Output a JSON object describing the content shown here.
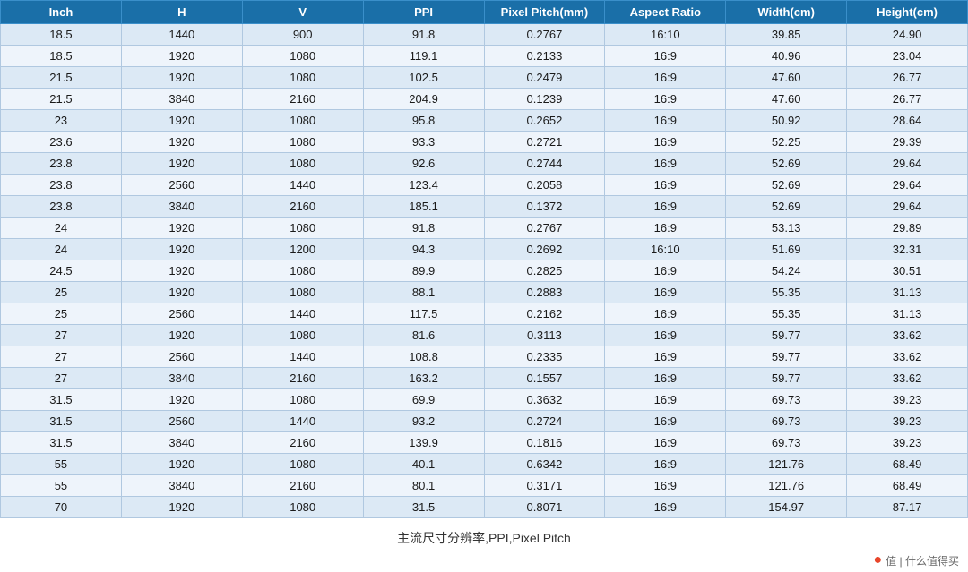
{
  "table": {
    "headers": [
      "Inch",
      "H",
      "V",
      "PPI",
      "Pixel Pitch(mm)",
      "Aspect Ratio",
      "Width(cm)",
      "Height(cm)"
    ],
    "rows": [
      [
        "18.5",
        "1440",
        "900",
        "91.8",
        "0.2767",
        "16:10",
        "39.85",
        "24.90"
      ],
      [
        "18.5",
        "1920",
        "1080",
        "119.1",
        "0.2133",
        "16:9",
        "40.96",
        "23.04"
      ],
      [
        "21.5",
        "1920",
        "1080",
        "102.5",
        "0.2479",
        "16:9",
        "47.60",
        "26.77"
      ],
      [
        "21.5",
        "3840",
        "2160",
        "204.9",
        "0.1239",
        "16:9",
        "47.60",
        "26.77"
      ],
      [
        "23",
        "1920",
        "1080",
        "95.8",
        "0.2652",
        "16:9",
        "50.92",
        "28.64"
      ],
      [
        "23.6",
        "1920",
        "1080",
        "93.3",
        "0.2721",
        "16:9",
        "52.25",
        "29.39"
      ],
      [
        "23.8",
        "1920",
        "1080",
        "92.6",
        "0.2744",
        "16:9",
        "52.69",
        "29.64"
      ],
      [
        "23.8",
        "2560",
        "1440",
        "123.4",
        "0.2058",
        "16:9",
        "52.69",
        "29.64"
      ],
      [
        "23.8",
        "3840",
        "2160",
        "185.1",
        "0.1372",
        "16:9",
        "52.69",
        "29.64"
      ],
      [
        "24",
        "1920",
        "1080",
        "91.8",
        "0.2767",
        "16:9",
        "53.13",
        "29.89"
      ],
      [
        "24",
        "1920",
        "1200",
        "94.3",
        "0.2692",
        "16:10",
        "51.69",
        "32.31"
      ],
      [
        "24.5",
        "1920",
        "1080",
        "89.9",
        "0.2825",
        "16:9",
        "54.24",
        "30.51"
      ],
      [
        "25",
        "1920",
        "1080",
        "88.1",
        "0.2883",
        "16:9",
        "55.35",
        "31.13"
      ],
      [
        "25",
        "2560",
        "1440",
        "117.5",
        "0.2162",
        "16:9",
        "55.35",
        "31.13"
      ],
      [
        "27",
        "1920",
        "1080",
        "81.6",
        "0.3113",
        "16:9",
        "59.77",
        "33.62"
      ],
      [
        "27",
        "2560",
        "1440",
        "108.8",
        "0.2335",
        "16:9",
        "59.77",
        "33.62"
      ],
      [
        "27",
        "3840",
        "2160",
        "163.2",
        "0.1557",
        "16:9",
        "59.77",
        "33.62"
      ],
      [
        "31.5",
        "1920",
        "1080",
        "69.9",
        "0.3632",
        "16:9",
        "69.73",
        "39.23"
      ],
      [
        "31.5",
        "2560",
        "1440",
        "93.2",
        "0.2724",
        "16:9",
        "69.73",
        "39.23"
      ],
      [
        "31.5",
        "3840",
        "2160",
        "139.9",
        "0.1816",
        "16:9",
        "69.73",
        "39.23"
      ],
      [
        "55",
        "1920",
        "1080",
        "40.1",
        "0.6342",
        "16:9",
        "121.76",
        "68.49"
      ],
      [
        "55",
        "3840",
        "2160",
        "80.1",
        "0.3171",
        "16:9",
        "121.76",
        "68.49"
      ],
      [
        "70",
        "1920",
        "1080",
        "31.5",
        "0.8071",
        "16:9",
        "154.97",
        "87.17"
      ]
    ]
  },
  "footer": {
    "caption": "主流尺寸分辨率,PPI,Pixel Pitch",
    "logo_text": "值 | 什么值得买",
    "logo_symbol": "●"
  }
}
